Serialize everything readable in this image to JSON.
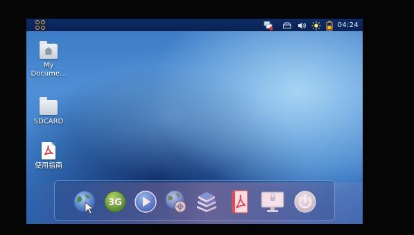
{
  "status_bar": {
    "launcher_icon": "app-grid-icon",
    "tray_icons": [
      "network-status-icon",
      "battery-slot-icon",
      "volume-icon",
      "brightness-icon",
      "battery-icon"
    ],
    "clock": "04:24",
    "colors": {
      "bar": "#0a2254",
      "launcher": "#ffb020"
    }
  },
  "desktop": {
    "icons": [
      {
        "label": "My Docume...",
        "icon": "home-folder-icon"
      },
      {
        "label": "SDCARD",
        "icon": "folder-icon"
      },
      {
        "label": "使用指南",
        "icon": "pdf-icon"
      }
    ]
  },
  "dock": {
    "items": [
      "web-browser-icon",
      "3g-icon",
      "media-player-icon",
      "network-icon",
      "books-icon",
      "pdf-reader-icon",
      "display-settings-icon",
      "power-icon"
    ],
    "badge_3g": "3G"
  }
}
